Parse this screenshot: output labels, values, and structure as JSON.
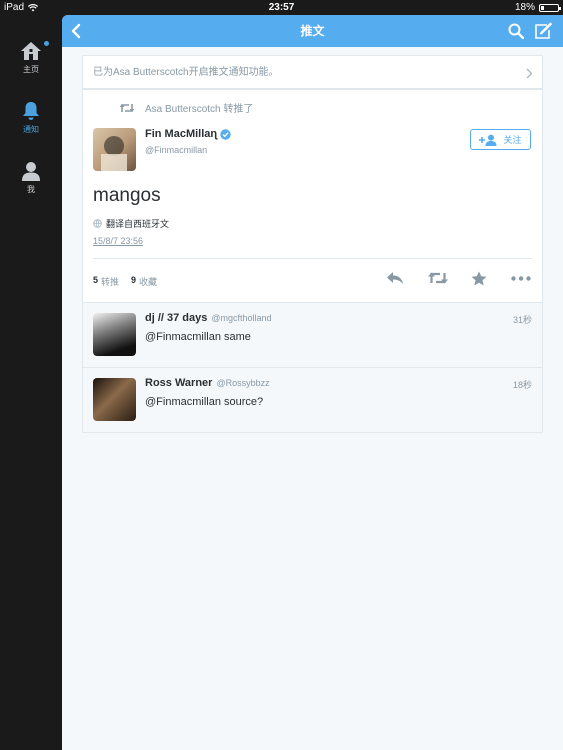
{
  "status_bar": {
    "device": "iPad",
    "time": "23:57",
    "battery": "18%",
    "battery_level": 0.18
  },
  "sidebar": {
    "items": [
      {
        "label": "主页",
        "icon": "home-icon",
        "active": false
      },
      {
        "label": "通知",
        "icon": "bell-icon",
        "active": true
      },
      {
        "label": "我",
        "icon": "person-icon",
        "active": false
      }
    ]
  },
  "navbar": {
    "title": "推文"
  },
  "notice": {
    "text": "已为Asa Butterscotch开启推文通知功能。"
  },
  "tweet": {
    "retweeted_by": "Asa Butterscotch 转推了",
    "author_name": "Fin MacMillaɳ",
    "author_handle": "@Finmacmillan",
    "follow_label": "关注",
    "text": "mangos",
    "translate_label": "翻译自西班牙文",
    "timestamp": "15/8/7 23:56",
    "retweet_count": "5",
    "retweet_label": "转推",
    "favorite_count": "9",
    "favorite_label": "收藏"
  },
  "replies": [
    {
      "name": "dj // 37 days",
      "handle": "@mgcftholland",
      "time": "31秒",
      "text": "@Finmacmillan same"
    },
    {
      "name": "Ross Warner",
      "handle": "@Rossybbzz",
      "time": "18秒",
      "text": "@Finmacmillan source?"
    }
  ],
  "colors": {
    "accent": "#55acee",
    "sidebar_bg": "#1a1a1a",
    "panel_bg": "#f5f8fa",
    "muted": "#8899a6"
  }
}
